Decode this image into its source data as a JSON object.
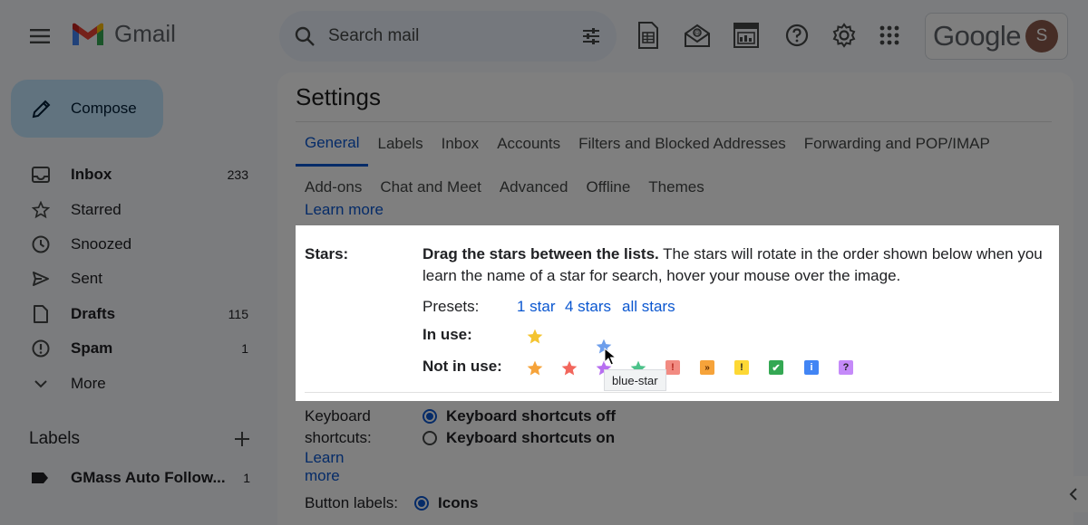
{
  "app": {
    "name": "Gmail"
  },
  "search": {
    "placeholder": "Search mail"
  },
  "account": {
    "brand": "Google",
    "avatar_letter": "S"
  },
  "sidebar": {
    "compose_label": "Compose",
    "items": [
      {
        "label": "Inbox",
        "count": "233",
        "bold": true,
        "icon": "inbox-icon"
      },
      {
        "label": "Starred",
        "count": "",
        "bold": false,
        "icon": "star-outline-icon"
      },
      {
        "label": "Snoozed",
        "count": "",
        "bold": false,
        "icon": "clock-icon"
      },
      {
        "label": "Sent",
        "count": "",
        "bold": false,
        "icon": "send-icon"
      },
      {
        "label": "Drafts",
        "count": "115",
        "bold": true,
        "icon": "draft-icon"
      },
      {
        "label": "Spam",
        "count": "1",
        "bold": true,
        "icon": "spam-icon"
      },
      {
        "label": "More",
        "count": "",
        "bold": false,
        "icon": "chevron-down-icon"
      }
    ],
    "labels_heading": "Labels",
    "label_items": [
      {
        "label": "GMass Auto Follow...",
        "count": "1"
      }
    ]
  },
  "settings": {
    "title": "Settings",
    "tabs_row1": [
      "General",
      "Labels",
      "Inbox",
      "Accounts",
      "Filters and Blocked Addresses",
      "Forwarding and POP/IMAP"
    ],
    "tabs_row2": [
      "Add-ons",
      "Chat and Meet",
      "Advanced",
      "Offline",
      "Themes"
    ],
    "active_tab": "General",
    "learn_more": "Learn more",
    "stars": {
      "label": "Stars:",
      "desc_bold": "Drag the stars between the lists.",
      "desc_rest": " The stars will rotate in the order shown below when you learn the name of a star for search, hover your mouse over the image.",
      "presets_label": "Presets:",
      "presets": [
        "1 star",
        "4 stars",
        "all stars"
      ],
      "in_use_label": "In use:",
      "not_in_use_label": "Not in use:",
      "tooltip": "blue-star"
    },
    "keyboard": {
      "label": "Keyboard shortcuts:",
      "options": [
        "Keyboard shortcuts off",
        "Keyboard shortcuts on"
      ],
      "selected": 0,
      "learn_more": "Learn more"
    },
    "button_labels": {
      "label": "Button labels:",
      "option": "Icons"
    }
  },
  "colors": {
    "yellow_star": "#f4c430",
    "orange_star": "#f6a33a",
    "red_star": "#f2665c",
    "purple_star": "#b76ff0",
    "blue_star": "#6d9eeb",
    "green_star": "#4cc28a",
    "accent": "#0b57d0"
  }
}
